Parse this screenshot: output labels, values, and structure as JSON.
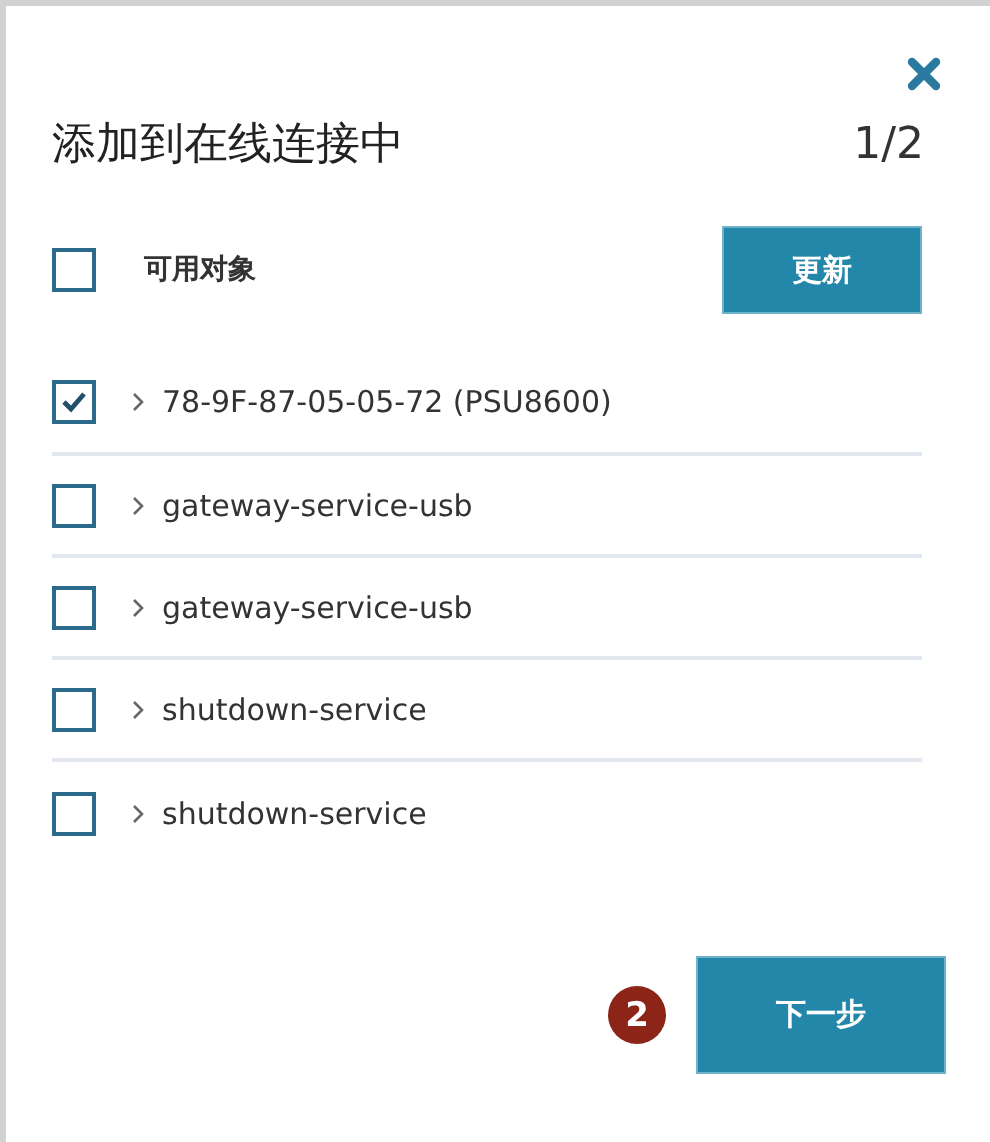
{
  "dialog": {
    "title": "添加到在线连接中",
    "step": "1/2"
  },
  "header": {
    "label": "可用对象",
    "checked": false,
    "refresh_button": "更新"
  },
  "items": [
    {
      "label": "78-9F-87-05-05-72 (PSU8600)",
      "checked": true
    },
    {
      "label": "gateway-service-usb",
      "checked": false
    },
    {
      "label": "gateway-service-usb",
      "checked": false
    },
    {
      "label": "shutdown-service",
      "checked": false
    },
    {
      "label": "shutdown-service",
      "checked": false
    }
  ],
  "footer": {
    "step_marker": "2",
    "next_button": "下一步"
  }
}
